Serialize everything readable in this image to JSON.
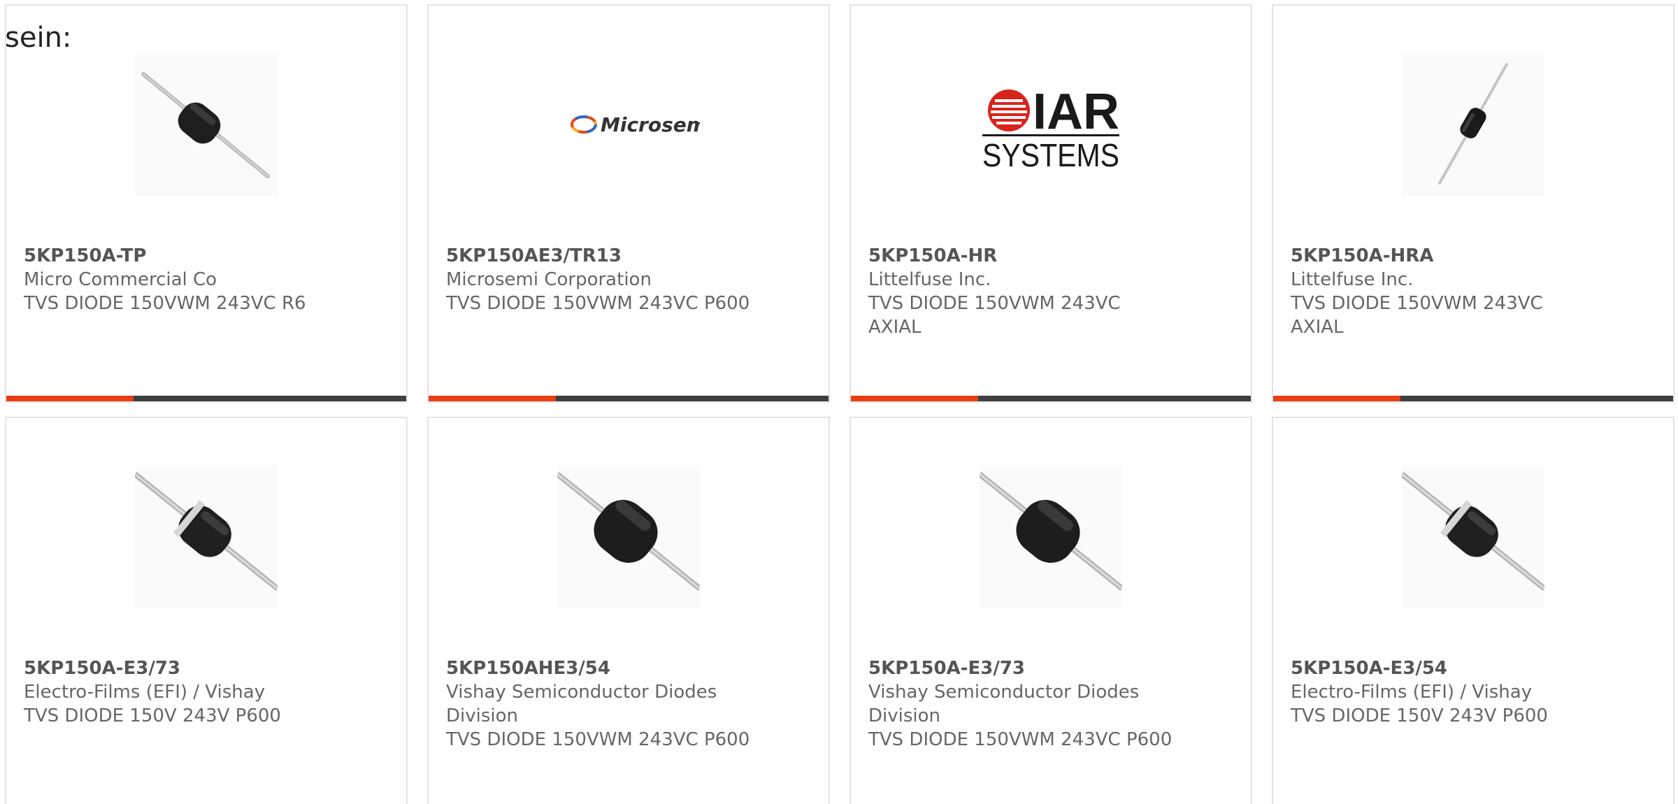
{
  "intro_text": "sein:",
  "colors": {
    "accent": "#e83e12",
    "bar": "#3e3e3e",
    "card_border": "#e3e3e3",
    "text": "#666666"
  },
  "products": [
    {
      "part_number": "5KP150A-TP",
      "manufacturer": "Micro Commercial Co",
      "description": "TVS DIODE 150VWM 243VC R6",
      "image": "axial-diode-small-image"
    },
    {
      "part_number": "5KP150AE3/TR13",
      "manufacturer": "Microsemi Corporation",
      "description": "TVS DIODE 150VWM 243VC P600",
      "image": "microsemi-logo",
      "logo_text": "Microsemi"
    },
    {
      "part_number": "5KP150A-HR",
      "manufacturer": "Littelfuse Inc.",
      "description": "TVS DIODE 150VWM 243VC AXIAL",
      "image": "iar-systems-logo",
      "logo_text_top": "IAR",
      "logo_text_bottom": "SYSTEMS"
    },
    {
      "part_number": "5KP150A-HRA",
      "manufacturer": "Littelfuse Inc.",
      "description": "TVS DIODE 150VWM 243VC AXIAL",
      "image": "axial-diode-thin-image"
    },
    {
      "part_number": "5KP150A-E3/73",
      "manufacturer": "Electro-Films (EFI) / Vishay",
      "description": "TVS DIODE 150V 243V P600",
      "image": "axial-diode-banded-image"
    },
    {
      "part_number": "5KP150AHE3/54",
      "manufacturer": "Vishay Semiconductor Diodes Division",
      "description": "TVS DIODE 150VWM 243VC P600",
      "image": "axial-diode-large-image"
    },
    {
      "part_number": "5KP150A-E3/73",
      "manufacturer": "Vishay Semiconductor Diodes Division",
      "description": "TVS DIODE 150VWM 243VC P600",
      "image": "axial-diode-large-image"
    },
    {
      "part_number": "5KP150A-E3/54",
      "manufacturer": "Electro-Films (EFI) / Vishay",
      "description": "TVS DIODE 150V 243V P600",
      "image": "axial-diode-banded-image"
    }
  ]
}
